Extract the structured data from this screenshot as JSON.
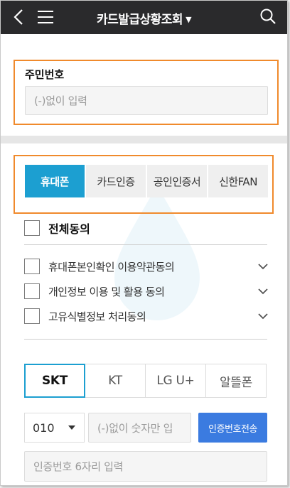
{
  "header": {
    "title": "카드발급상황조회",
    "back_icon": "back-arrow-icon",
    "menu_icon": "hamburger-menu-icon",
    "search_icon": "search-icon",
    "background": "#2a2a2c"
  },
  "resident_number": {
    "label": "주민번호",
    "placeholder": "(-)없이 입력"
  },
  "auth_tabs": {
    "items": [
      {
        "label": "휴대폰",
        "active": true
      },
      {
        "label": "카드인증",
        "active": false
      },
      {
        "label": "공인인증서",
        "active": false
      },
      {
        "label": "신한FAN",
        "active": false
      }
    ],
    "active_color": "#1c9fd1"
  },
  "agreements": {
    "all_label": "전체동의",
    "items": [
      {
        "label": "휴대폰본인확인 이용약관동의"
      },
      {
        "label": "개인정보 이용 및 활용 동의"
      },
      {
        "label": "고유식별정보 처리동의"
      }
    ]
  },
  "carriers": {
    "items": [
      {
        "label": "SKT",
        "active": true
      },
      {
        "label": "KT",
        "active": false
      },
      {
        "label": "LG U+",
        "active": false
      },
      {
        "label": "알뜰폰",
        "active": false
      }
    ]
  },
  "phone": {
    "prefix": "010",
    "placeholder": "(-)없이 숫자만 입",
    "send_label": "인증번호전송",
    "send_color": "#3b7be0"
  },
  "verification": {
    "placeholder": "인증번호 6자리 입력"
  },
  "highlight_color": "#f08a2c"
}
